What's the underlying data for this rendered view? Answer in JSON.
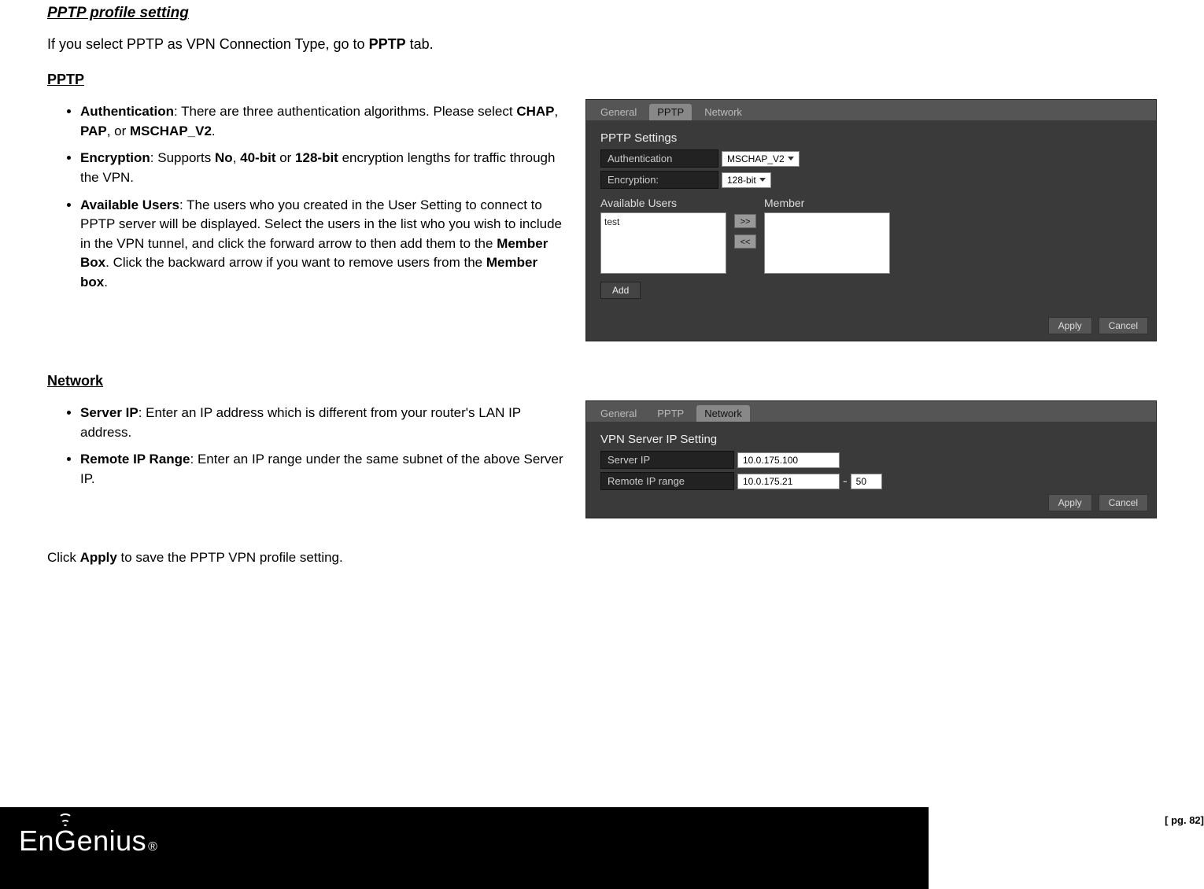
{
  "title": "PPTP profile setting",
  "lead_pre": "If you select PPTP as VPN Connection Type, go to ",
  "lead_bold": "PPTP",
  "lead_post": " tab.",
  "pptp_heading": "PPTP",
  "network_heading": "Network",
  "bullets_pptp": {
    "auth_label": "Authentication",
    "auth_text1": ": There are three authentication algorithms. Please select ",
    "auth_b1": "CHAP",
    "auth_sep1": ", ",
    "auth_b2": "PAP",
    "auth_sep2": ", or ",
    "auth_b3": "MSCHAP_V2",
    "auth_end": ".",
    "enc_label": "Encryption",
    "enc_text1": ": Supports ",
    "enc_b1": "No",
    "enc_sep1": ", ",
    "enc_b2": "40-bit",
    "enc_sep2": " or ",
    "enc_b3": "128-bit",
    "enc_text2": " encryption lengths for traffic through the VPN.",
    "avail_label": "Available Users",
    "avail_text1": ": The users who you created in the User Setting to connect to PPTP server will be displayed. Select the users in the list who you wish to include in the VPN tunnel, and click the forward arrow to then add them to the ",
    "avail_b1": "Member Box",
    "avail_text2": ". Click the backward arrow if you want to remove users from the ",
    "avail_b2": "Member box",
    "avail_end": "."
  },
  "bullets_net": {
    "srv_label": "Server IP",
    "srv_text": ": Enter an IP address which is different from your router's LAN IP address.",
    "rng_label": "Remote IP Range",
    "rng_text": ": Enter an IP range under the same subnet of the above Server IP."
  },
  "apply_line_pre": "Click ",
  "apply_line_b": "Apply",
  "apply_line_post": " to save the PPTP VPN profile setting.",
  "shot1": {
    "tabs": {
      "general": "General",
      "pptp": "PPTP",
      "network": "Network"
    },
    "panel_title": "PPTP Settings",
    "auth_label": "Authentication",
    "auth_value": "MSCHAP_V2",
    "enc_label": "Encryption:",
    "enc_value": "128-bit",
    "avail_label": "Available Users",
    "member_label": "Member",
    "avail_item": "test",
    "fwd": ">>",
    "back": "<<",
    "add": "Add",
    "apply": "Apply",
    "cancel": "Cancel"
  },
  "shot2": {
    "tabs": {
      "general": "General",
      "pptp": "PPTP",
      "network": "Network"
    },
    "panel_title": "VPN Server IP Setting",
    "srv_label": "Server IP",
    "srv_value": "10.0.175.100",
    "rng_label": "Remote IP range",
    "rng_value": "10.0.175.21",
    "rng_end": "50",
    "apply": "Apply",
    "cancel": "Cancel"
  },
  "logo_text": "EnGenius",
  "reg": "®",
  "page_num": "[ pg. 82]"
}
